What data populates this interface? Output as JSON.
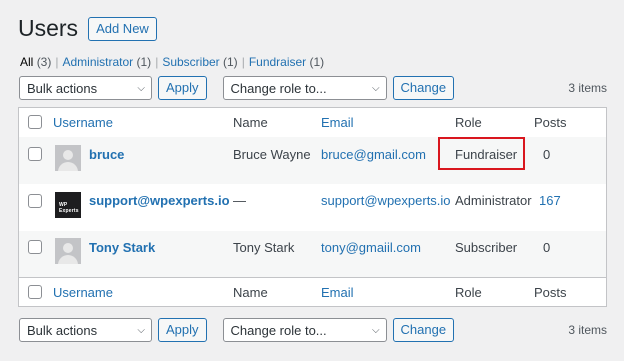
{
  "page": {
    "title": "Users",
    "add_new": "Add New"
  },
  "filters": {
    "all": {
      "label": "All",
      "count": "(3)"
    },
    "administrator": {
      "label": "Administrator",
      "count": "(1)"
    },
    "subscriber": {
      "label": "Subscriber",
      "count": "(1)"
    },
    "fundraiser": {
      "label": "Fundraiser",
      "count": "(1)"
    },
    "separator": "|"
  },
  "tablenav": {
    "bulk_actions": "Bulk actions",
    "apply": "Apply",
    "change_role": "Change role to...",
    "change": "Change",
    "items": "3 items"
  },
  "columns": {
    "username": "Username",
    "name": "Name",
    "email": "Email",
    "role": "Role",
    "posts": "Posts"
  },
  "users": [
    {
      "username": "bruce",
      "name": "Bruce Wayne",
      "email": "bruce@gmail.com",
      "role": "Fundraiser",
      "posts": "0",
      "avatar": "default-avatar"
    },
    {
      "username": "support@wpexperts.io",
      "name": "—",
      "email": "support@wpexperts.io",
      "role": "Administrator",
      "posts": "167",
      "avatar": "wpexperts-logo",
      "logo_text": "WP Experts"
    },
    {
      "username": "Tony Stark",
      "name": "Tony Stark",
      "email": "tony@gmaiil.com",
      "role": "Subscriber",
      "posts": "0",
      "avatar": "default-avatar"
    }
  ],
  "colors": {
    "link": "#2271b1",
    "border": "#c3c4c7",
    "highlight": "#d9161e",
    "background": "#f0f0f1"
  }
}
